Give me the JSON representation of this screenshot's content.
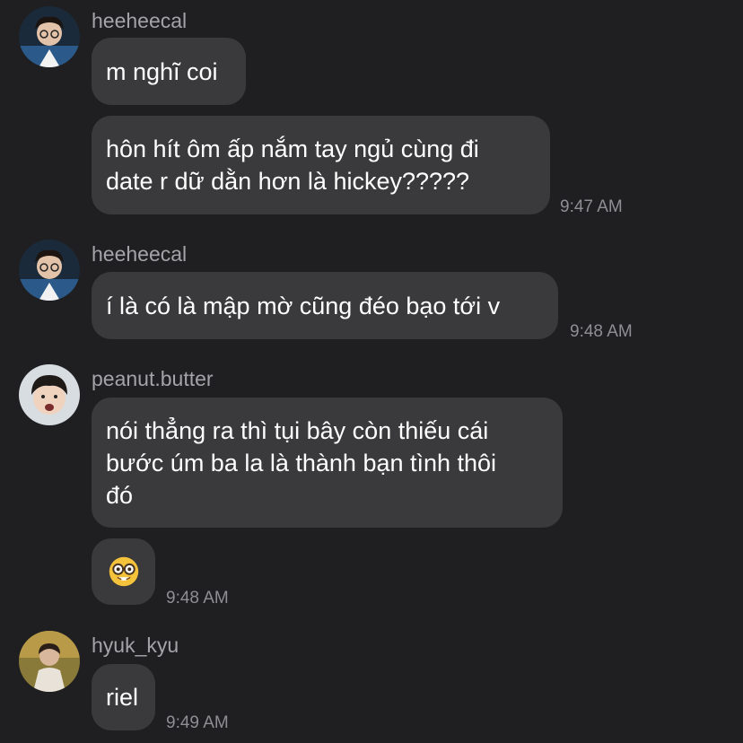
{
  "messages": [
    {
      "username": "heeheecal",
      "bubbles": [
        "m nghĩ coi",
        "hôn hít ôm ấp nắm tay ngủ cùng đi\ndate r dữ dằn hơn là hickey?????"
      ],
      "time": "9:47 AM"
    },
    {
      "username": "heeheecal",
      "bubbles": [
        "í là có là mập mờ cũng đéo bạo tới v"
      ],
      "time": "9:48 AM"
    },
    {
      "username": "peanut.butter",
      "bubbles": [
        "nói thẳng ra thì tụi bây còn thiếu cái\nbước úm ba la là thành bạn tình thôi\nđó",
        "🤓"
      ],
      "time": "9:48 AM"
    },
    {
      "username": "hyuk_kyu",
      "bubbles": [
        "riel"
      ],
      "time": "9:49 AM"
    }
  ],
  "icons": {
    "nerd_emoji": "nerd-face-emoji"
  }
}
